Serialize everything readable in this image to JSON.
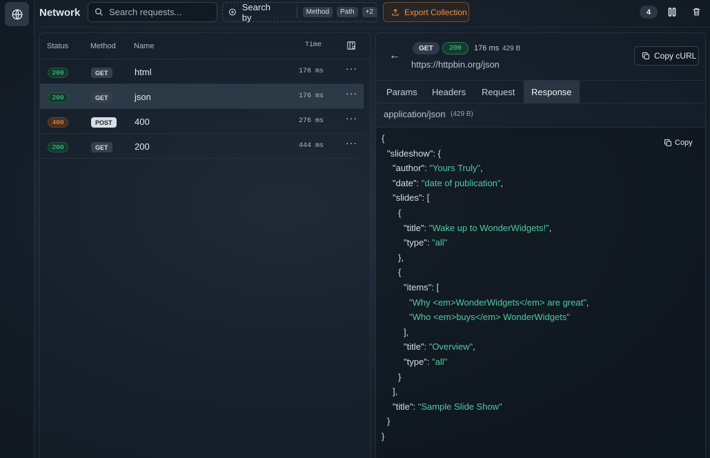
{
  "header": {
    "title": "Network",
    "search_placeholder": "Search requests...",
    "search_by_label": "Search by",
    "filter_chips": [
      "Method",
      "Path",
      "+2"
    ],
    "export_label": "Export Collection",
    "request_count": "4"
  },
  "table": {
    "columns": [
      "Status",
      "Method",
      "Name",
      "Time"
    ],
    "rows": [
      {
        "status": "200",
        "method": "GET",
        "name": "html",
        "time": "176 ms"
      },
      {
        "status": "200",
        "method": "GET",
        "name": "json",
        "time": "176 ms"
      },
      {
        "status": "400",
        "method": "POST",
        "name": "400",
        "time": "276 ms"
      },
      {
        "status": "200",
        "method": "GET",
        "name": "200",
        "time": "444 ms"
      }
    ]
  },
  "detail": {
    "method": "GET",
    "status": "200",
    "time": "176 ms",
    "size": "429 B",
    "url": "https://httpbin.org/json",
    "copy_curl_label": "Copy cURL",
    "tabs": [
      "Params",
      "Headers",
      "Request",
      "Response"
    ],
    "content_type": "application/json",
    "content_size": "(429 B)",
    "copy_label": "Copy",
    "json_lines": [
      {
        "indent": 0,
        "key": "",
        "value": "",
        "punct": "{"
      },
      {
        "indent": 1,
        "key": "\"slideshow\"",
        "value": "",
        "punct": ": {"
      },
      {
        "indent": 2,
        "key": "\"author\"",
        "value": "\"Yours Truly\"",
        "punct": ","
      },
      {
        "indent": 2,
        "key": "\"date\"",
        "value": "\"date of publication\"",
        "punct": ","
      },
      {
        "indent": 2,
        "key": "\"slides\"",
        "value": "",
        "punct": ": ["
      },
      {
        "indent": 3,
        "key": "",
        "value": "",
        "punct": "{"
      },
      {
        "indent": 4,
        "key": "\"title\"",
        "value": "\"Wake up to WonderWidgets!\"",
        "punct": ","
      },
      {
        "indent": 4,
        "key": "\"type\"",
        "value": "\"all\"",
        "punct": ""
      },
      {
        "indent": 3,
        "key": "",
        "value": "",
        "punct": "},"
      },
      {
        "indent": 3,
        "key": "",
        "value": "",
        "punct": "{"
      },
      {
        "indent": 4,
        "key": "\"items\"",
        "value": "",
        "punct": ": ["
      },
      {
        "indent": 5,
        "key": "",
        "value": "\"Why <em>WonderWidgets</em> are great\"",
        "punct": ","
      },
      {
        "indent": 5,
        "key": "",
        "value": "\"Who <em>buys</em> WonderWidgets\"",
        "punct": ""
      },
      {
        "indent": 4,
        "key": "",
        "value": "",
        "punct": "],"
      },
      {
        "indent": 4,
        "key": "\"title\"",
        "value": "\"Overview\"",
        "punct": ","
      },
      {
        "indent": 4,
        "key": "\"type\"",
        "value": "\"all\"",
        "punct": ""
      },
      {
        "indent": 3,
        "key": "",
        "value": "",
        "punct": "}"
      },
      {
        "indent": 2,
        "key": "",
        "value": "",
        "punct": "],"
      },
      {
        "indent": 2,
        "key": "\"title\"",
        "value": "\"Sample Slide Show\"",
        "punct": ""
      },
      {
        "indent": 1,
        "key": "",
        "value": "",
        "punct": "}"
      },
      {
        "indent": 0,
        "key": "",
        "value": "",
        "punct": "}"
      }
    ]
  },
  "colors": {
    "accent_green": "#4fd39a",
    "accent_orange": "#f0904a",
    "json_value": "#4fcc9a"
  }
}
